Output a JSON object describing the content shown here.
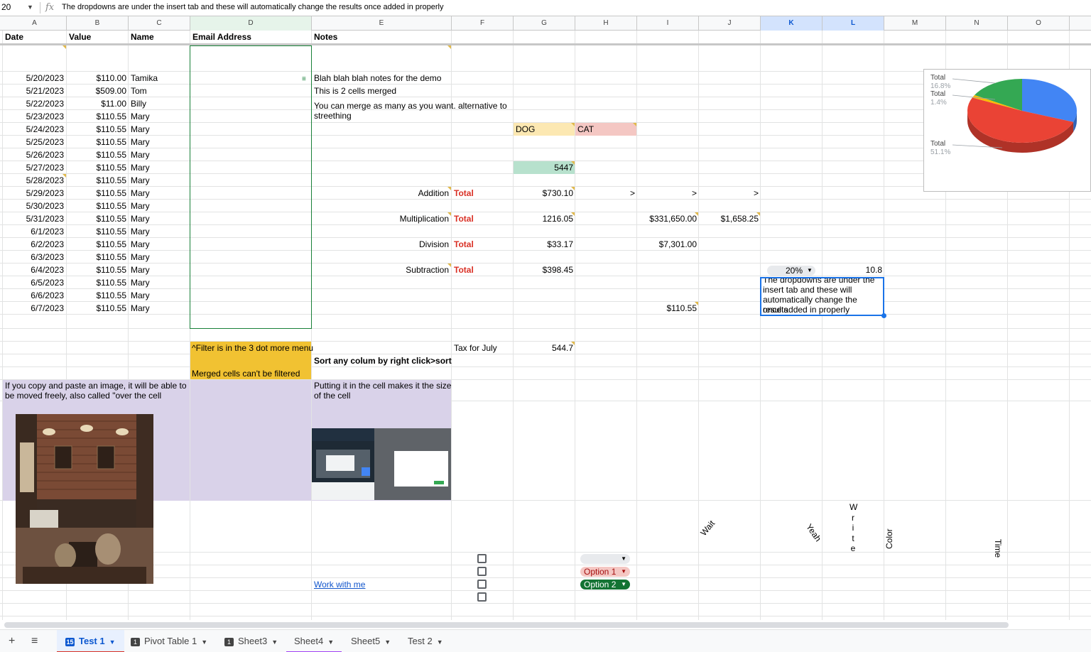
{
  "formula_bar": {
    "cell_ref": "20",
    "fx": "fx",
    "content": "The dropdowns are under the insert tab and these will automatically change the results once added in properly"
  },
  "columns": [
    "A",
    "B",
    "C",
    "D",
    "E",
    "F",
    "G",
    "H",
    "I",
    "J",
    "K",
    "L",
    "M",
    "N",
    "O"
  ],
  "headers": {
    "date": "Date",
    "value": "Value",
    "name": "Name",
    "email": "Email Address",
    "notes": "Notes"
  },
  "rows": [
    {
      "date": "5/20/2023",
      "value": "$110.00",
      "name": "Tamika"
    },
    {
      "date": "5/21/2023",
      "value": "$509.00",
      "name": "Tom"
    },
    {
      "date": "5/22/2023",
      "value": "$11.00",
      "name": "Billy"
    },
    {
      "date": "5/23/2023",
      "value": "$110.55",
      "name": "Mary"
    },
    {
      "date": "5/24/2023",
      "value": "$110.55",
      "name": "Mary"
    },
    {
      "date": "5/25/2023",
      "value": "$110.55",
      "name": "Mary"
    },
    {
      "date": "5/26/2023",
      "value": "$110.55",
      "name": "Mary"
    },
    {
      "date": "5/27/2023",
      "value": "$110.55",
      "name": "Mary"
    },
    {
      "date": "5/28/2023",
      "value": "$110.55",
      "name": "Mary"
    },
    {
      "date": "5/29/2023",
      "value": "$110.55",
      "name": "Mary"
    },
    {
      "date": "5/30/2023",
      "value": "$110.55",
      "name": "Mary"
    },
    {
      "date": "5/31/2023",
      "value": "$110.55",
      "name": "Mary"
    },
    {
      "date": "6/1/2023",
      "value": "$110.55",
      "name": "Mary"
    },
    {
      "date": "6/2/2023",
      "value": "$110.55",
      "name": "Mary"
    },
    {
      "date": "6/3/2023",
      "value": "$110.55",
      "name": "Mary"
    },
    {
      "date": "6/4/2023",
      "value": "$110.55",
      "name": "Mary"
    },
    {
      "date": "6/5/2023",
      "value": "$110.55",
      "name": "Mary"
    },
    {
      "date": "6/6/2023",
      "value": "$110.55",
      "name": "Mary"
    },
    {
      "date": "6/7/2023",
      "value": "$110.55",
      "name": "Mary"
    }
  ],
  "notes": {
    "n1": "Blah blah blah notes for the demo",
    "n2": "This is 2 cells merged",
    "n3a": "You can merge as many as you want. alternative to",
    "n3b": "streething"
  },
  "labels": {
    "dog": "DOG",
    "cat": "CAT",
    "num5447": "5447"
  },
  "ops": [
    {
      "name": "Addition",
      "total": "Total",
      "g": "$730.10",
      "h": ">",
      "i": ">",
      "j": ">"
    },
    {
      "name": "Multiplication",
      "total": "Total",
      "g": "1216.05",
      "i": "$331,650.00",
      "j": "$1,658.25"
    },
    {
      "name": "Division",
      "total": "Total",
      "g": "$33.17",
      "i": "$7,301.00"
    },
    {
      "name": "Subtraction",
      "total": "Total",
      "g": "$398.45"
    }
  ],
  "pct_dropdown": "20%",
  "k_value": "10.8",
  "k_note": [
    "The dropdowns are under the",
    "insert tab and these will",
    "automatically change the results",
    "once added in properly"
  ],
  "i_last": "$110.55",
  "filter_note": "^Filter is in the 3 dot more menu",
  "merged_note": "Merged cells can't be filtered",
  "tax_label": "Tax for July",
  "tax_value": "544.7",
  "sort_note": "Sort any colum by right click>sort",
  "image_note_a": [
    "If you copy and paste an image, it will be able to",
    "be moved freely, also called \"over the cell"
  ],
  "image_note_e": [
    "Putting it in the cell makes it the size",
    "of the cell"
  ],
  "rotated": {
    "wait": "Wait",
    "yeah": "Yeah",
    "write": [
      "W",
      "r",
      "i",
      "t",
      "e"
    ],
    "color": "Color",
    "time": "Time"
  },
  "link": "Work with me",
  "chips": {
    "opt1": "Option 1",
    "opt2": "Option 2"
  },
  "chart_data": {
    "type": "pie",
    "labels": [
      "Total",
      "Total",
      "Total"
    ],
    "slices": [
      {
        "label": "Total",
        "pct_label": "16.8%",
        "value": 16.8,
        "color": "#34a853"
      },
      {
        "label": "Total",
        "pct_label": "1.4%",
        "value": 1.4,
        "color": "#fbbc04"
      },
      {
        "label": "Total",
        "pct_label": "51.1%",
        "value": 51.1,
        "color": "#ea4335"
      },
      {
        "label": "",
        "pct_label": "",
        "value": 30.7,
        "color": "#4285f4"
      }
    ]
  },
  "tabs": [
    {
      "label": "Test 1",
      "icon": "15",
      "active": true
    },
    {
      "label": "Pivot Table 1",
      "icon": "1"
    },
    {
      "label": "Sheet3",
      "icon": "1"
    },
    {
      "label": "Sheet4"
    },
    {
      "label": "Sheet5"
    },
    {
      "label": "Test 2"
    }
  ]
}
